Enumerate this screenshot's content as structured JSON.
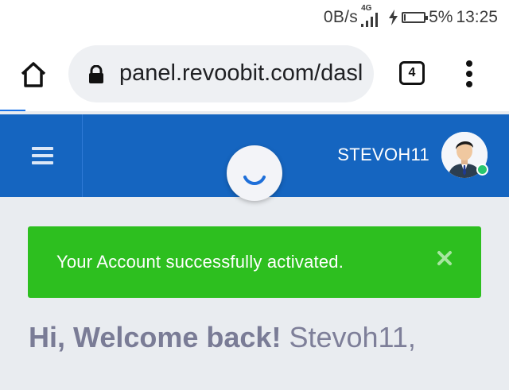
{
  "status_bar": {
    "net_speed": "0B/s",
    "network_type": "4G",
    "battery_percent_text": "5%",
    "battery_level": 0.05,
    "time": "13:25"
  },
  "browser": {
    "url": "panel.revoobit.com/dasl",
    "tab_count": "4",
    "load_progress": 0.05,
    "icons": [
      "home-icon",
      "lock-icon",
      "tabs-icon",
      "more-vert-icon"
    ]
  },
  "header": {
    "username": "STEVOH11",
    "colors": {
      "header_bg": "#1565c0",
      "online": "#28c76f"
    },
    "icons": [
      "menu-icon",
      "spinner-icon",
      "avatar"
    ]
  },
  "alert": {
    "message": "Your Account successfully activated.",
    "close_glyph": "×",
    "color": "#2dbf1f"
  },
  "welcome": {
    "greeting": "Hi, Welcome back!",
    "name": "Stevoh11,"
  }
}
